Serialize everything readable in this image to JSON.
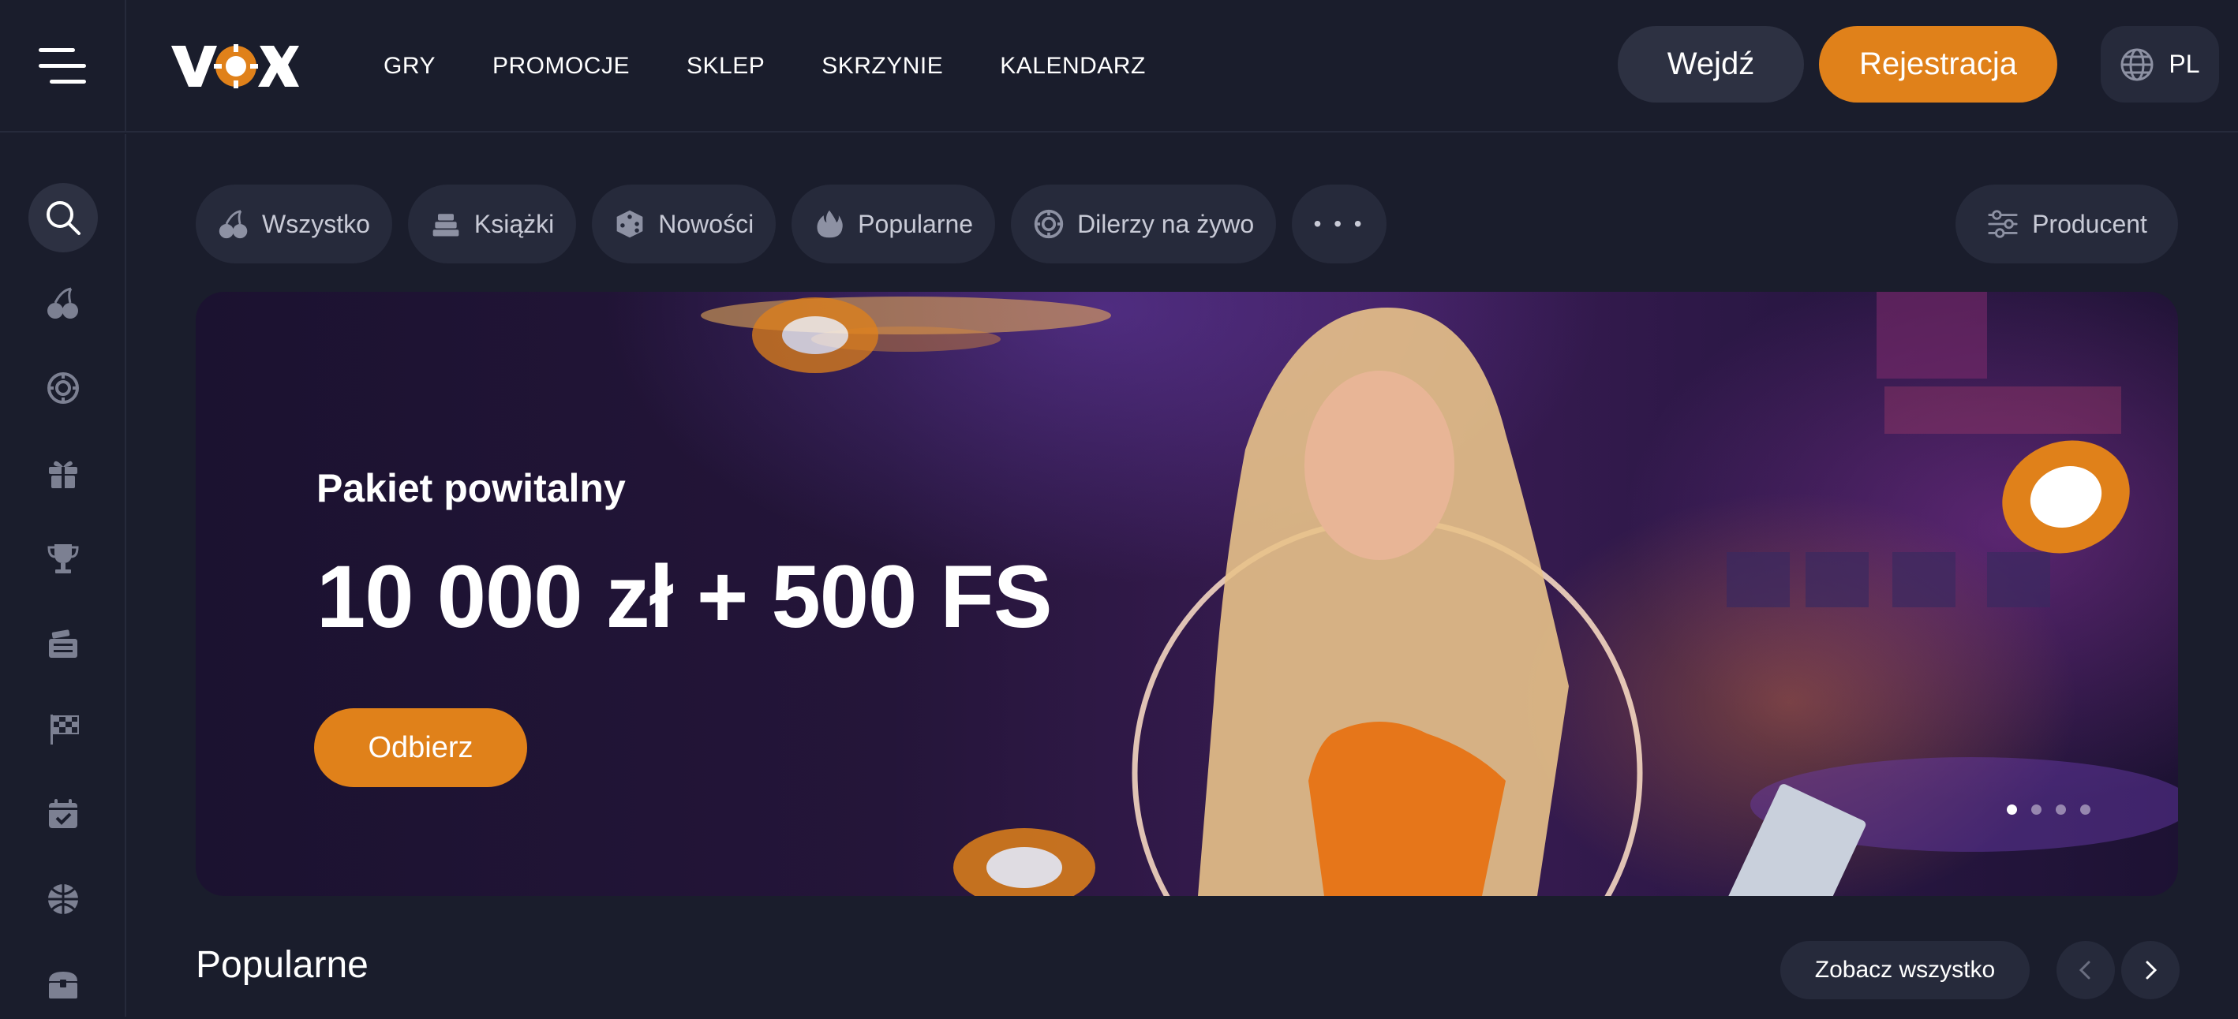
{
  "header": {
    "logo": "VOX",
    "nav": [
      "GRY",
      "PROMOCJE",
      "SKLEP",
      "SKRZYNIE",
      "KALENDARZ"
    ],
    "login_label": "Wejdź",
    "register_label": "Rejestracja",
    "language": "PL"
  },
  "sidebar": {
    "icons": [
      "search-icon",
      "cherries-icon",
      "poker-chip-icon",
      "gift-icon",
      "trophy-icon",
      "lottery-icon",
      "racing-flag-icon",
      "calendar-check-icon",
      "sports-ball-icon",
      "treasure-chest-icon"
    ]
  },
  "filters": {
    "chips": [
      "Wszystko",
      "Książki",
      "Nowości",
      "Popularne",
      "Dilerzy na żywo"
    ],
    "more_label": "• • •",
    "producer_label": "Producent"
  },
  "banner": {
    "subtitle": "Pakiet powitalny",
    "title": "10 000 zł + 500 FS",
    "button_label": "Odbierz",
    "slides_total": 4,
    "active_slide": 1
  },
  "popular": {
    "title": "Popularne",
    "see_all_label": "Zobacz wszystko"
  },
  "colors": {
    "background": "#1a1d2c",
    "surface": "#262a3b",
    "accent": "#e0811a"
  }
}
